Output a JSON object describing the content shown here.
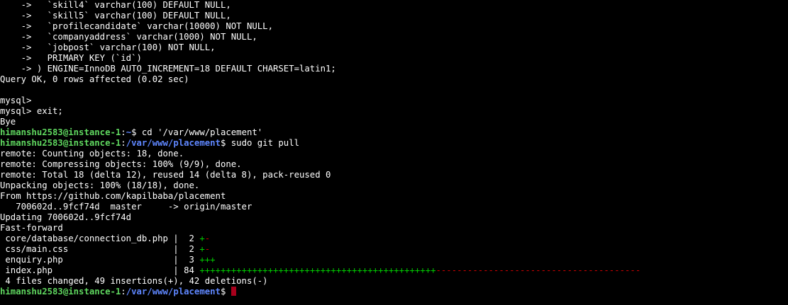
{
  "terminal": {
    "lines": [
      {
        "type": "text",
        "text": "    ->   `skill4` varchar(100) DEFAULT NULL,"
      },
      {
        "type": "text",
        "text": "    ->   `skill5` varchar(100) DEFAULT NULL,"
      },
      {
        "type": "text",
        "text": "    ->   `profilecandidate` varchar(10000) NOT NULL,"
      },
      {
        "type": "text",
        "text": "    ->   `companyaddress` varchar(1000) NOT NULL,"
      },
      {
        "type": "text",
        "text": "    ->   `jobpost` varchar(100) NOT NULL,"
      },
      {
        "type": "text",
        "text": "    ->   PRIMARY KEY (`id`)"
      },
      {
        "type": "text",
        "text": "    -> ) ENGINE=InnoDB AUTO_INCREMENT=18 DEFAULT CHARSET=latin1;"
      },
      {
        "type": "text",
        "text": "Query OK, 0 rows affected (0.02 sec)"
      },
      {
        "type": "text",
        "text": ""
      },
      {
        "type": "text",
        "text": "mysql>"
      },
      {
        "type": "text",
        "text": "mysql> exit;"
      },
      {
        "type": "text",
        "text": "Bye"
      },
      {
        "type": "prompt",
        "user": "himanshu2583@instance-1",
        "sep": ":",
        "path": "~",
        "symbol": "$ ",
        "command": "cd '/var/www/placement'"
      },
      {
        "type": "prompt",
        "user": "himanshu2583@instance-1",
        "sep": ":",
        "path": "/var/www/placement",
        "symbol": "$ ",
        "command": "sudo git pull"
      },
      {
        "type": "text",
        "text": "remote: Counting objects: 18, done."
      },
      {
        "type": "text",
        "text": "remote: Compressing objects: 100% (9/9), done."
      },
      {
        "type": "text",
        "text": "remote: Total 18 (delta 12), reused 14 (delta 8), pack-reused 0"
      },
      {
        "type": "text",
        "text": "Unpacking objects: 100% (18/18), done."
      },
      {
        "type": "text",
        "text": "From https://github.com/kapilbaba/placement"
      },
      {
        "type": "text",
        "text": "   700602d..9fcf74d  master     -> origin/master"
      },
      {
        "type": "text",
        "text": "Updating 700602d..9fcf74d"
      },
      {
        "type": "text",
        "text": "Fast-forward"
      },
      {
        "type": "diffstat",
        "file": " core/database/connection_db.php | ",
        "count": " 2 ",
        "plus": "+",
        "minus": "-"
      },
      {
        "type": "diffstat",
        "file": " css/main.css                    | ",
        "count": " 2 ",
        "plus": "+",
        "minus": "-"
      },
      {
        "type": "diffstat",
        "file": " enquiry.php                     | ",
        "count": " 3 ",
        "plus": "+++",
        "minus": ""
      },
      {
        "type": "diffstat",
        "file": " index.php                       | ",
        "count": "84 ",
        "plus": "+++++++++++++++++++++++++++++++++++++++++++++",
        "minus": "---------------------------------------"
      },
      {
        "type": "text",
        "text": " 4 files changed, 49 insertions(+), 42 deletions(-)"
      },
      {
        "type": "prompt",
        "user": "himanshu2583@instance-1",
        "sep": ":",
        "path": "/var/www/placement",
        "symbol": "$ ",
        "command": "",
        "cursor": true
      }
    ]
  },
  "colors": {
    "background": "#000000",
    "text": "#ffffff",
    "user": "#5fd75f",
    "path": "#5f87ff",
    "plus": "#00cd00",
    "minus": "#cd0000",
    "cursor": "#a8001c"
  }
}
